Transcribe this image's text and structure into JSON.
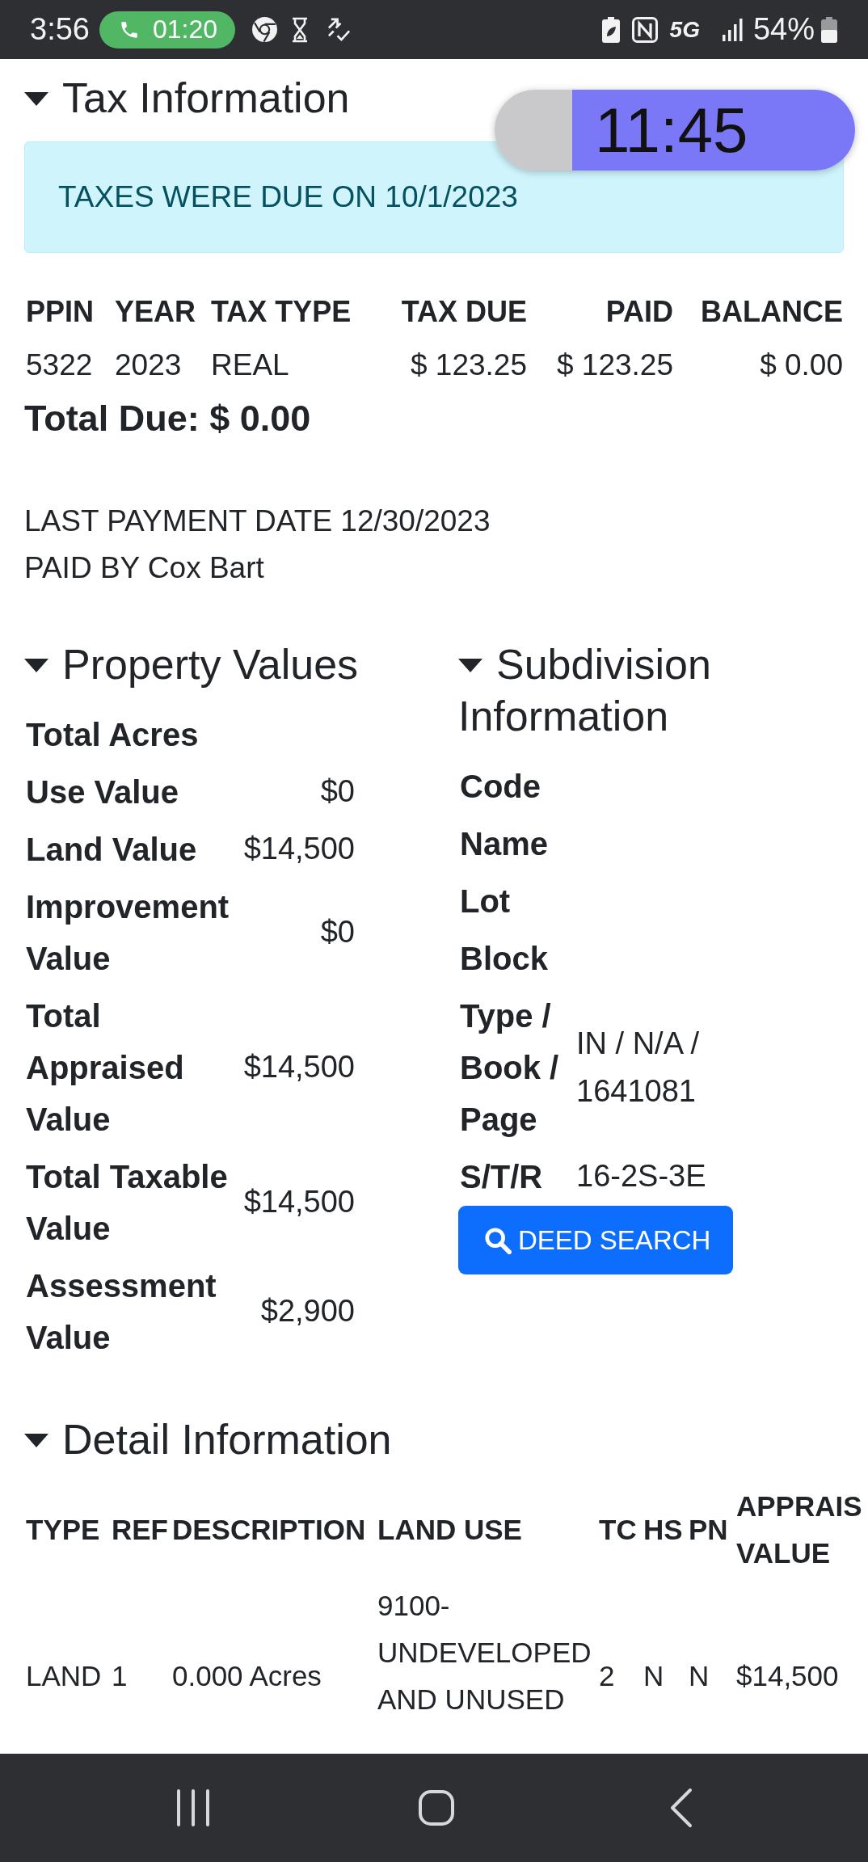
{
  "status_bar": {
    "time": "3:56",
    "call_timer": "01:20",
    "network": "5G",
    "battery": "54%"
  },
  "overlay_timer": {
    "time": "11:45"
  },
  "tax_information": {
    "title": "Tax Information",
    "expanded": true,
    "alert": "TAXES WERE DUE ON 10/1/2023",
    "table": {
      "columns": [
        "PPIN",
        "YEAR",
        "TAX TYPE",
        "TAX DUE",
        "PAID",
        "BALANCE"
      ],
      "rows": [
        [
          "5322",
          "2023",
          "REAL",
          "$ 123.25",
          "$ 123.25",
          "$ 0.00"
        ]
      ]
    },
    "total_due": "Total Due: $ 0.00",
    "last_payment": "LAST PAYMENT DATE 12/30/2023",
    "paid_by": "PAID BY Cox Bart"
  },
  "property_values": {
    "title": "Property Values",
    "expanded": true,
    "rows": [
      {
        "label": "Total Acres"
      },
      {
        "label": "Use Value",
        "value": "$0"
      },
      {
        "label": "Land Value",
        "value": "$14,500"
      },
      {
        "label": "Improvement Value",
        "value": "$0"
      },
      {
        "label": "Total Appraised Value",
        "value": "$14,500"
      },
      {
        "label": "Total Taxable Value",
        "value": "$14,500"
      },
      {
        "label": "Assessment Value",
        "value": "$2,900"
      }
    ]
  },
  "subdivision_information": {
    "title": "Subdivision Information",
    "expanded": true,
    "rows": [
      {
        "label": "Code"
      },
      {
        "label": "Name"
      },
      {
        "label": "Lot"
      },
      {
        "label": "Block"
      },
      {
        "label": "Type / Book / Page",
        "value": "IN / N/A / 1641081"
      },
      {
        "label": "S/T/R",
        "value": "16-2S-3E"
      }
    ],
    "button": "DEED SEARCH"
  },
  "detail_information": {
    "title": "Detail Information",
    "expanded": true,
    "table": {
      "columns": [
        "TYPE",
        "REF",
        "DESCRIPTION",
        "LAND USE",
        "TC",
        "HS",
        "PN",
        "APPRAIS VALUE"
      ],
      "rows": [
        [
          "LAND",
          "1",
          "0.000 Acres",
          "9100-UNDEVELOPED AND UNUSED",
          "2",
          "N",
          "N",
          "$14,500"
        ]
      ]
    }
  }
}
